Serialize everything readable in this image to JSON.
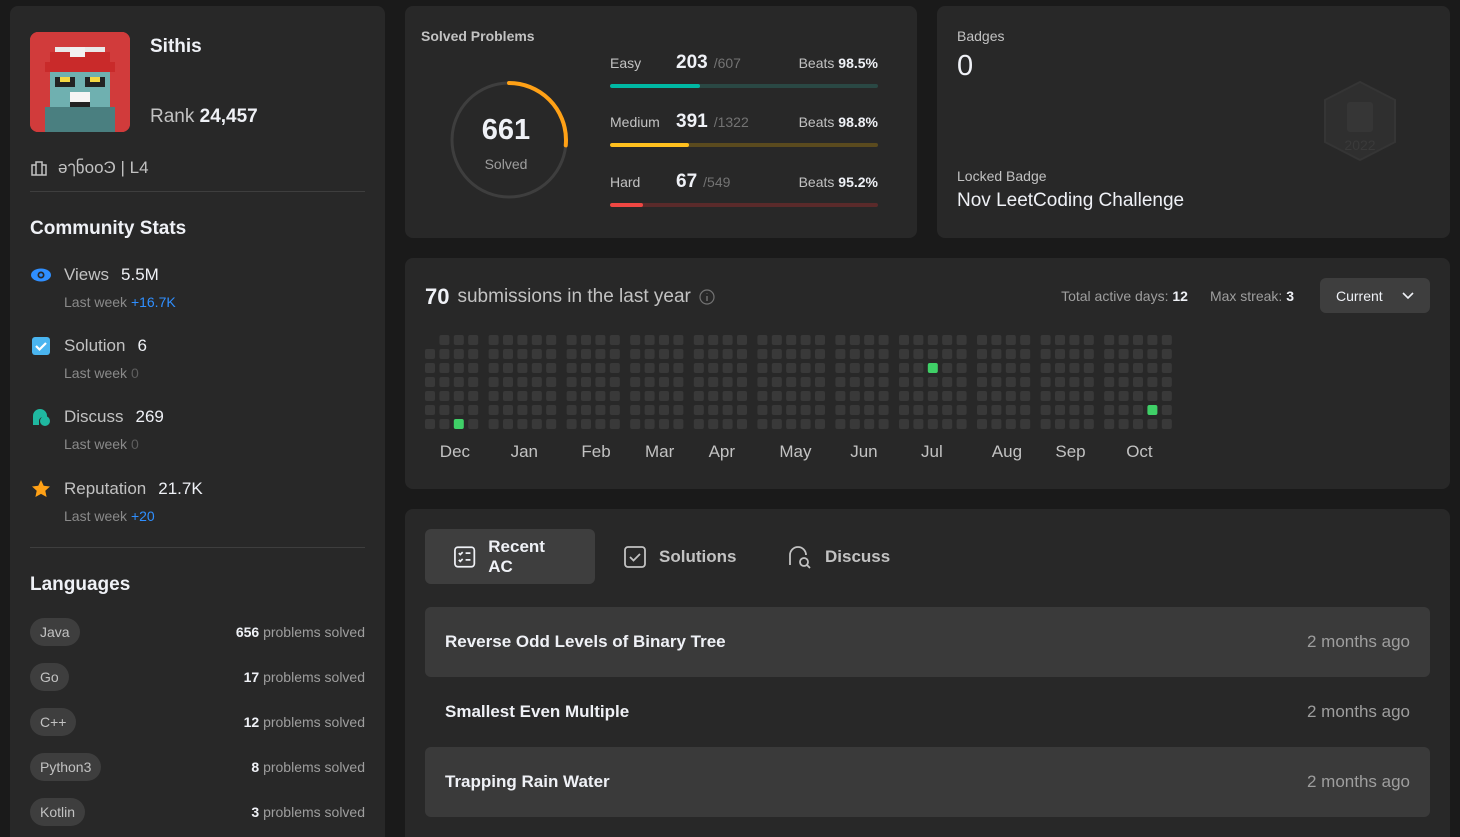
{
  "profile": {
    "username": "Sithis",
    "rank_label": "Rank",
    "rank_value": "24,457",
    "org": " әๅნooϿ | L4"
  },
  "community": {
    "title": "Community Stats",
    "views": {
      "label": "Views",
      "value": "5.5M",
      "last_week_label": "Last week",
      "last_week": "+16.7K"
    },
    "solution": {
      "label": "Solution",
      "value": "6",
      "last_week_label": "Last week",
      "last_week": "0"
    },
    "discuss": {
      "label": "Discuss",
      "value": "269",
      "last_week_label": "Last week",
      "last_week": "0"
    },
    "reputation": {
      "label": "Reputation",
      "value": "21.7K",
      "last_week_label": "Last week",
      "last_week": "+20"
    }
  },
  "languages": {
    "title": "Languages",
    "suffix": "problems solved",
    "items": [
      {
        "name": "Java",
        "count": "656"
      },
      {
        "name": "Go",
        "count": "17"
      },
      {
        "name": "C++",
        "count": "12"
      },
      {
        "name": "Python3",
        "count": "8"
      },
      {
        "name": "Kotlin",
        "count": "3"
      }
    ]
  },
  "solved": {
    "title": "Solved Problems",
    "total": "661",
    "total_label": "Solved",
    "total_fraction": 0.265,
    "beats_label": "Beats",
    "easy": {
      "label": "Easy",
      "solved": "203",
      "total": "/607",
      "beats": "98.5%",
      "fraction": 0.334,
      "color": "#00b8a3",
      "track": "#2a4844"
    },
    "medium": {
      "label": "Medium",
      "solved": "391",
      "total": "/1322",
      "beats": "98.8%",
      "fraction": 0.296,
      "color": "#ffc01e",
      "track": "#5a4a1e"
    },
    "hard": {
      "label": "Hard",
      "solved": "67",
      "total": "/549",
      "beats": "95.2%",
      "fraction": 0.122,
      "color": "#ef4743",
      "track": "#5a2a2a"
    }
  },
  "badges": {
    "label": "Badges",
    "count": "0",
    "locked_label": "Locked Badge",
    "locked_name": "Nov LeetCoding Challenge",
    "badge_year": "2022"
  },
  "submissions": {
    "count": "70",
    "text": "submissions in the last year",
    "active_days_label": "Total active days:",
    "active_days": "12",
    "max_streak_label": "Max streak:",
    "max_streak": "3",
    "dropdown": "Current",
    "months": [
      "Dec",
      "Jan",
      "Feb",
      "Mar",
      "Apr",
      "May",
      "Jun",
      "Jul",
      "Aug",
      "Sep",
      "Oct"
    ]
  },
  "recent": {
    "tabs": [
      "Recent AC",
      "Solutions",
      "Discuss"
    ],
    "items": [
      {
        "title": "Reverse Odd Levels of Binary Tree",
        "ago": "2 months ago"
      },
      {
        "title": "Smallest Even Multiple",
        "ago": "2 months ago"
      },
      {
        "title": "Trapping Rain Water",
        "ago": "2 months ago"
      }
    ]
  },
  "colors": {
    "empty_cell": "#393939",
    "green_light": "#2ea043",
    "green_bright": "#3fd067",
    "accent_blue": "#2f8fff"
  }
}
